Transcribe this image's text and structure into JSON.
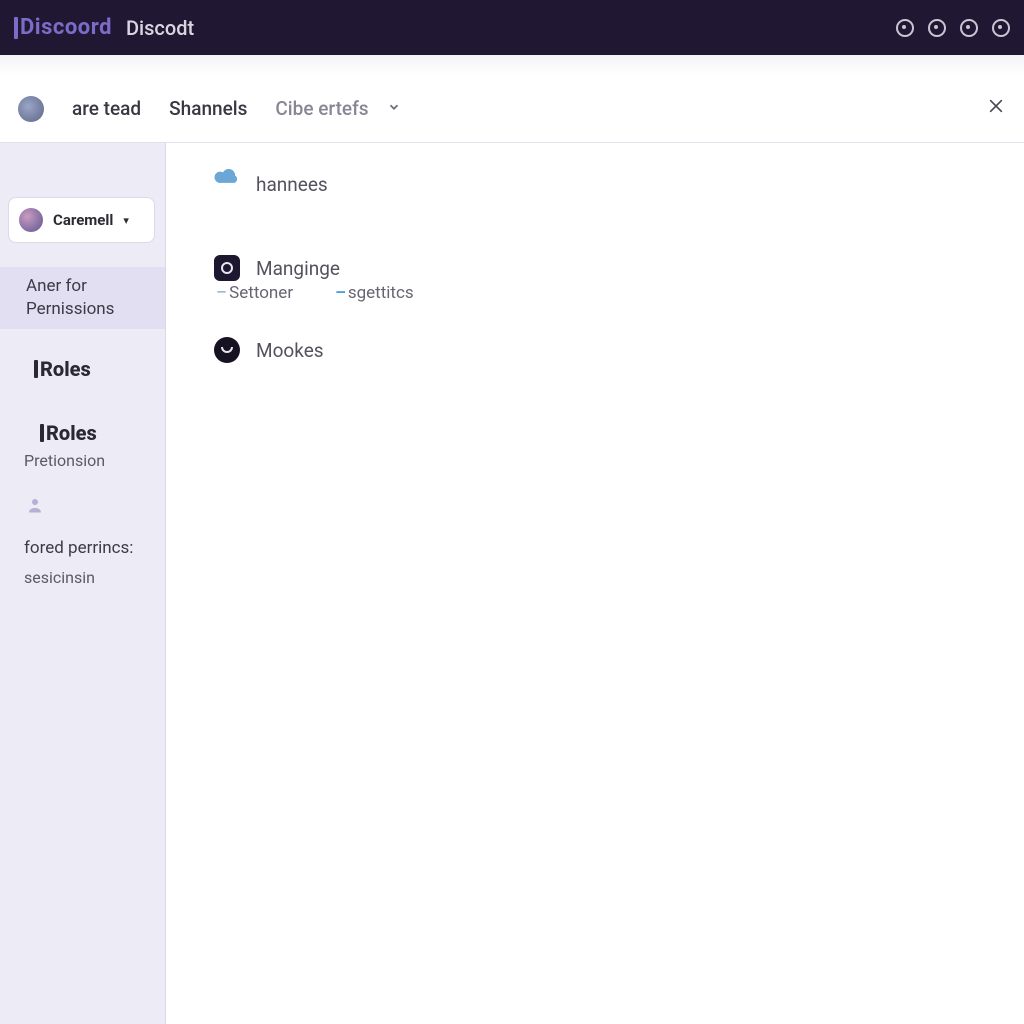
{
  "topbar": {
    "logo_text": "Discoord",
    "title": "Discodt"
  },
  "secondbar": {
    "items": [
      "are tead",
      "Shannels",
      "Cibe ertefs"
    ]
  },
  "sidebar": {
    "user_name": "Caremell",
    "item_permissions_line1": "Aner for",
    "item_permissions_line2": "Pernissions",
    "heading_roles": "Roles",
    "heading_roles2": "Roles",
    "sub_pretionsion": "Pretionsion",
    "sub_ored": "fored perrincs:",
    "sub_sesic": "sesicinsin"
  },
  "content": {
    "row_channels": "hannees",
    "row_manage": "Manginge",
    "tab_settoner": "Settoner",
    "tab_sgettits": "sgettitcs",
    "row_mookes": "Mookes"
  }
}
